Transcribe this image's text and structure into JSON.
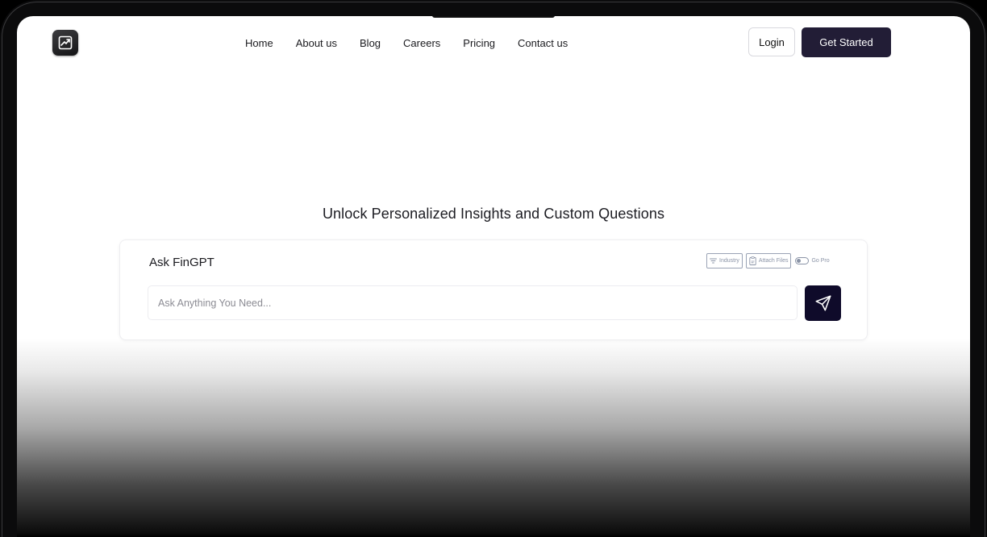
{
  "nav": {
    "items": [
      {
        "label": "Home"
      },
      {
        "label": "About us"
      },
      {
        "label": "Blog"
      },
      {
        "label": "Careers"
      },
      {
        "label": "Pricing"
      },
      {
        "label": "Contact us"
      }
    ]
  },
  "header": {
    "login_label": "Login",
    "cta_label": "Get Started",
    "logo_icon": "logo-icon"
  },
  "hero": {
    "headline": "Unlock Personalized Insights and Custom Questions"
  },
  "ask": {
    "title": "Ask FinGPT",
    "industry_label": "Industry",
    "attach_label": "Attach Files",
    "pro_label": "Go Pro",
    "pro_toggle_on": false,
    "placeholder": "Ask Anything You Need...",
    "send_icon": "send-icon"
  },
  "colors": {
    "primary_dark": "#221d36",
    "send_bg": "#0f0b2a"
  }
}
